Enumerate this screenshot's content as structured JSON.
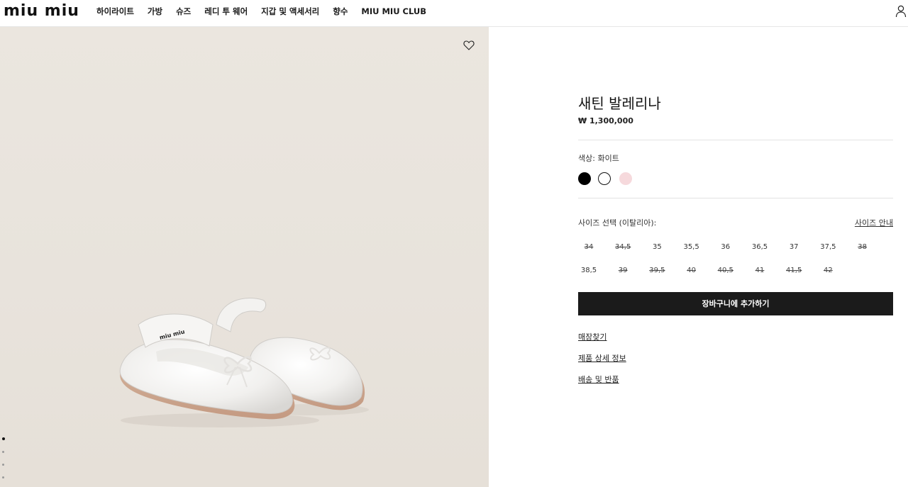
{
  "header": {
    "logo": "miu miu",
    "nav": [
      "하이라이트",
      "가방",
      "슈즈",
      "레디 투 웨어",
      "지갑 및 액세서리",
      "향수",
      "MIU MIU CLUB"
    ],
    "account_icon": "user-icon"
  },
  "media": {
    "wishlist_icon": "heart-icon",
    "background_color": "#e9e4dd",
    "carousel_dots": 4,
    "active_dot": 0
  },
  "product": {
    "title": "새틴 발레리나",
    "price": "₩ 1,300,000",
    "color_label": "색상:",
    "color_value": "화이트",
    "colors": [
      {
        "name": "black",
        "hex": "#000000"
      },
      {
        "name": "white",
        "hex": "#ffffff"
      },
      {
        "name": "pink",
        "hex": "#f6d9dc"
      }
    ],
    "selected_color": "white",
    "size_label": "사이즈 선택 (이탈리아):",
    "size_guide": "사이즈 안내",
    "sizes": [
      {
        "label": "34",
        "available": false
      },
      {
        "label": "34,5",
        "available": false
      },
      {
        "label": "35",
        "available": true
      },
      {
        "label": "35,5",
        "available": true
      },
      {
        "label": "36",
        "available": true
      },
      {
        "label": "36,5",
        "available": true
      },
      {
        "label": "37",
        "available": true
      },
      {
        "label": "37,5",
        "available": true
      },
      {
        "label": "38",
        "available": false
      },
      {
        "label": "38,5",
        "available": true
      },
      {
        "label": "39",
        "available": false
      },
      {
        "label": "39,5",
        "available": false
      },
      {
        "label": "40",
        "available": false
      },
      {
        "label": "40,5",
        "available": false
      },
      {
        "label": "41",
        "available": false
      },
      {
        "label": "41,5",
        "available": false
      },
      {
        "label": "42",
        "available": false
      }
    ],
    "add_to_cart": "장바구니에 추가하기",
    "links": [
      "매장찾기",
      "제품 상세 정보",
      "배송 및 반품"
    ]
  }
}
